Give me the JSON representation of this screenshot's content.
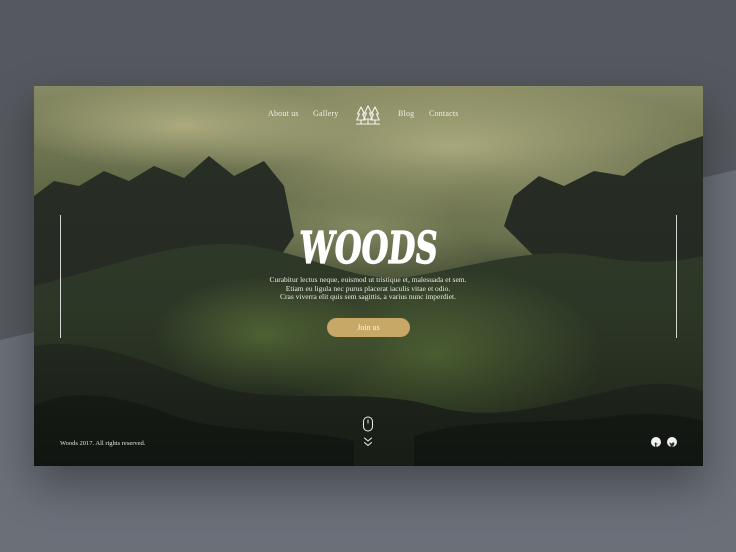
{
  "nav": {
    "items": [
      {
        "label": "About us"
      },
      {
        "label": "Gallery"
      },
      {
        "label": "Blog"
      },
      {
        "label": "Contacts"
      }
    ],
    "logo_icon": "three-pine-trees-icon"
  },
  "hero": {
    "title": "WOODS",
    "tagline": [
      "Curabitur lectus neque, euismod ut tristique et, malesuada et sem.",
      "Etiam eu ligula nec purus placerat iaculis vitae et odio.",
      "Cras viverra elit quis sem sagittis, a varius nunc imperdiet."
    ],
    "cta_label": "Join us"
  },
  "scroll": {
    "mouse_icon": "mouse-scroll-icon",
    "chevron_icon": "double-chevron-down-icon"
  },
  "footer": {
    "copyright": "Woods 2017. All rights reserved.",
    "social_icons": [
      "tumblr-icon",
      "twitter-icon"
    ]
  },
  "colors": {
    "accent": "#c8a867",
    "background": "#55595f",
    "hero_dark": "#2a2d2a",
    "text_light": "#eef0e6"
  }
}
